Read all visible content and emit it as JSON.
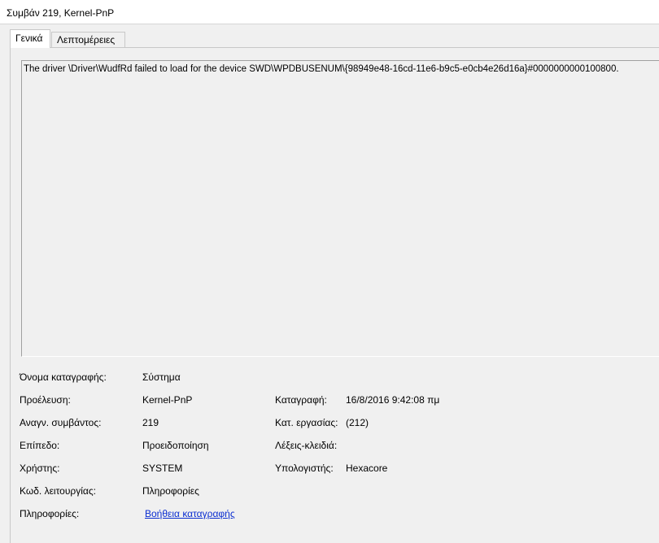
{
  "window": {
    "title": "Συμβάν 219, Kernel-PnP"
  },
  "tabs": [
    {
      "label": "Γενικά"
    },
    {
      "label": "Λεπτομέρειες"
    }
  ],
  "description": "The driver \\Driver\\WudfRd failed to load for the device SWD\\WPDBUSENUM\\{98949e48-16cd-11e6-b9c5-e0cb4e26d16a}#0000000000100800.",
  "fields": {
    "log_name": {
      "label": "Όνομα καταγραφής:",
      "value": "Σύστημα"
    },
    "source": {
      "label": "Προέλευση:",
      "value": "Kernel-PnP"
    },
    "logged": {
      "label": "Καταγραφή:",
      "value": "16/8/2016 9:42:08 πμ"
    },
    "event_id": {
      "label": "Αναγν. συμβάντος:",
      "value": "219"
    },
    "task_category": {
      "label": "Κατ. εργασίας:",
      "value": "(212)"
    },
    "level": {
      "label": "Επίπεδο:",
      "value": "Προειδοποίηση"
    },
    "keywords": {
      "label": "Λέξεις-κλειδιά:",
      "value": ""
    },
    "user": {
      "label": "Χρήστης:",
      "value": "SYSTEM"
    },
    "computer": {
      "label": "Υπολογιστής:",
      "value": "Hexacore"
    },
    "opcode": {
      "label": "Κωδ. λειτουργίας:",
      "value": "Πληροφορίες"
    },
    "more_info": {
      "label": "Πληροφορίες:",
      "link": "Βοήθεια καταγραφής"
    }
  },
  "colors": {
    "link": "#0b2ed1",
    "background": "#f0f0f0"
  }
}
